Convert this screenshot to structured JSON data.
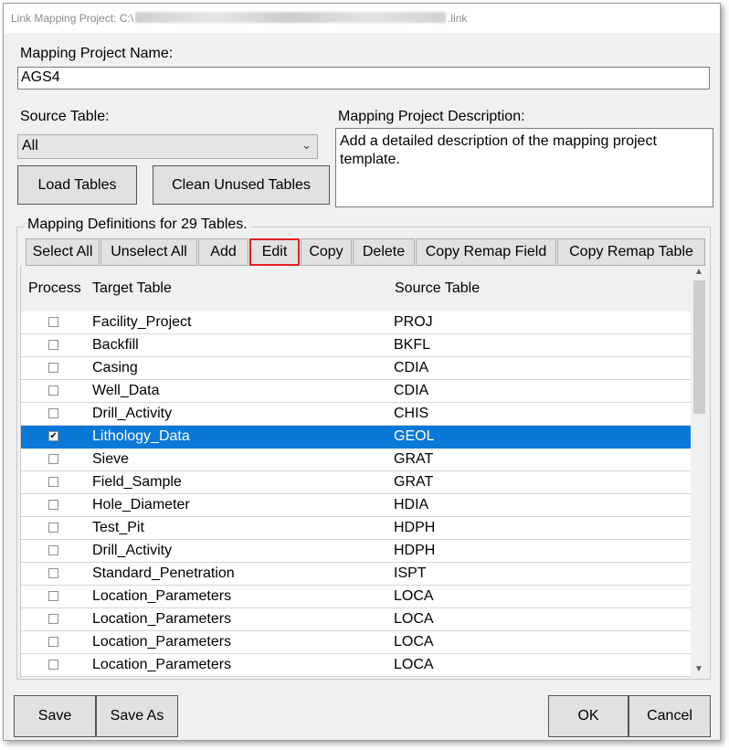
{
  "window": {
    "title_prefix": "Link Mapping Project: C:\\",
    "title_suffix": ".link"
  },
  "project_name": {
    "label": "Mapping Project Name:",
    "value": "AGS4"
  },
  "source_table": {
    "label": "Source Table:",
    "value": "All"
  },
  "description": {
    "label": "Mapping Project Description:",
    "value": "Add a detailed description of the mapping project template."
  },
  "buttons": {
    "load_tables": "Load Tables",
    "clean_unused": "Clean Unused Tables",
    "save": "Save",
    "save_as": "Save As",
    "ok": "OK",
    "cancel": "Cancel"
  },
  "group": {
    "title": "Mapping Definitions for 29 Tables."
  },
  "toolbar": {
    "select_all": "Select All",
    "unselect_all": "Unselect All",
    "add": "Add",
    "edit": "Edit",
    "copy": "Copy",
    "delete": "Delete",
    "copy_remap_field": "Copy Remap Field",
    "copy_remap_table": "Copy Remap Table"
  },
  "grid": {
    "columns": {
      "process": "Process",
      "target": "Target Table",
      "source": "Source Table"
    },
    "rows": [
      {
        "target": "Facility_Project",
        "source": "PROJ",
        "checked": false
      },
      {
        "target": "Backfill",
        "source": "BKFL",
        "checked": false
      },
      {
        "target": "Casing",
        "source": "CDIA",
        "checked": false
      },
      {
        "target": "Well_Data",
        "source": "CDIA",
        "checked": false
      },
      {
        "target": "Drill_Activity",
        "source": "CHIS",
        "checked": false
      },
      {
        "target": "Lithology_Data",
        "source": "GEOL",
        "checked": true,
        "selected": true
      },
      {
        "target": "Sieve",
        "source": "GRAT",
        "checked": false
      },
      {
        "target": "Field_Sample",
        "source": "GRAT",
        "checked": false
      },
      {
        "target": "Hole_Diameter",
        "source": "HDIA",
        "checked": false
      },
      {
        "target": "Test_Pit",
        "source": "HDPH",
        "checked": false
      },
      {
        "target": "Drill_Activity",
        "source": "HDPH",
        "checked": false
      },
      {
        "target": "Standard_Penetration",
        "source": "ISPT",
        "checked": false
      },
      {
        "target": "Location_Parameters",
        "source": "LOCA",
        "checked": false
      },
      {
        "target": "Location_Parameters",
        "source": "LOCA",
        "checked": false
      },
      {
        "target": "Location_Parameters",
        "source": "LOCA",
        "checked": false
      },
      {
        "target": "Location_Parameters",
        "source": "LOCA",
        "checked": false
      }
    ]
  },
  "colors": {
    "selection": "#0a78d7",
    "edit_highlight": "#e02020"
  },
  "icons": {
    "dropdown": "chevron-down-icon",
    "scroll_up": "arrow-up-icon",
    "scroll_down": "arrow-down-icon",
    "checkbox": "checkbox-icon"
  }
}
